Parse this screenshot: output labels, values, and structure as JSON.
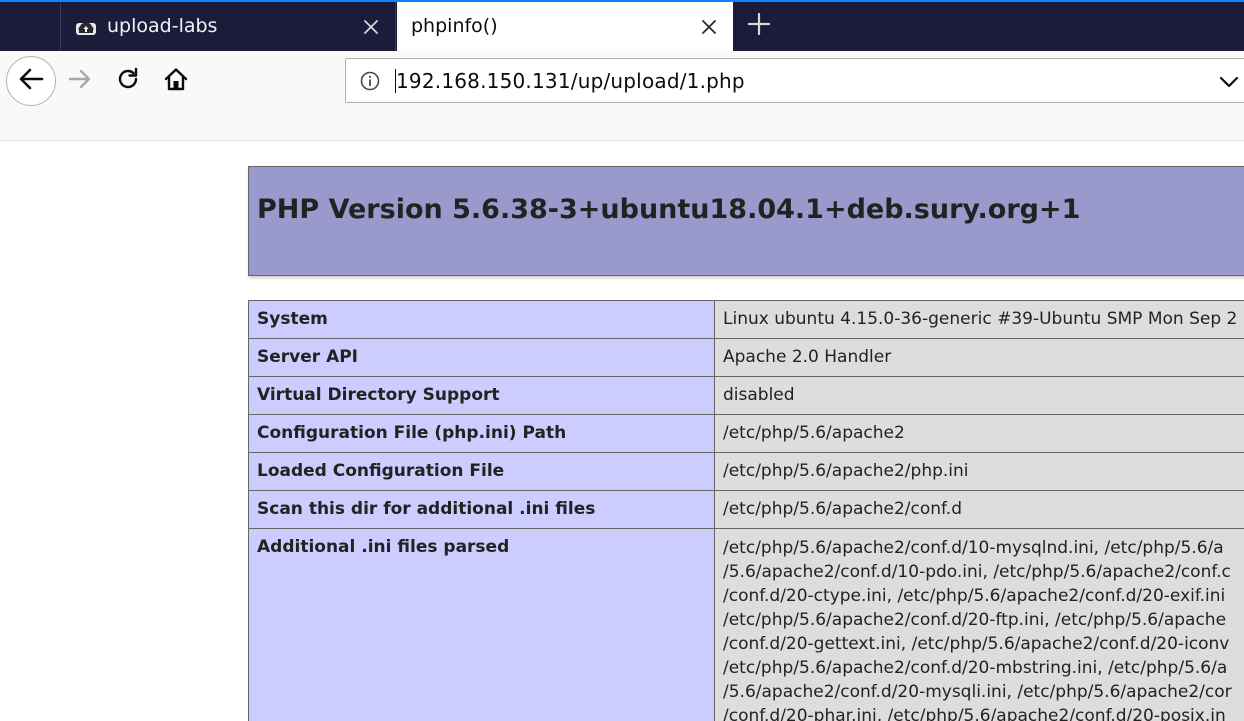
{
  "browser": {
    "tabs": [
      {
        "label": "upload-labs",
        "active": false,
        "favicon": "cloud-icon"
      },
      {
        "label": "phpinfo()",
        "active": true
      }
    ],
    "url": "192.168.150.131/up/upload/1.php",
    "colors": {
      "tabstrip": "#1c1b3a",
      "accent": "#0a84ff",
      "navbar": "#f9f9fa"
    }
  },
  "page": {
    "title": "PHP Version 5.6.38-3+ubuntu18.04.1+deb.sury.org+1",
    "colors": {
      "header": "#9999cc",
      "key_cell": "#ccccff",
      "value_cell": "#dddddd"
    },
    "rows": [
      {
        "key": "System",
        "value": "Linux ubuntu 4.15.0-36-generic #39-Ubuntu SMP Mon Sep 2"
      },
      {
        "key": "Server API",
        "value": "Apache 2.0 Handler"
      },
      {
        "key": "Virtual Directory Support",
        "value": "disabled"
      },
      {
        "key": "Configuration File (php.ini) Path",
        "value": "/etc/php/5.6/apache2"
      },
      {
        "key": "Loaded Configuration File",
        "value": "/etc/php/5.6/apache2/php.ini"
      },
      {
        "key": "Scan this dir for additional .ini files",
        "value": "/etc/php/5.6/apache2/conf.d"
      }
    ],
    "additional": {
      "key": "Additional .ini files parsed",
      "lines": [
        "/etc/php/5.6/apache2/conf.d/10-mysqlnd.ini, /etc/php/5.6/a",
        "/5.6/apache2/conf.d/10-pdo.ini, /etc/php/5.6/apache2/conf.c",
        "/conf.d/20-ctype.ini, /etc/php/5.6/apache2/conf.d/20-exif.ini",
        "/etc/php/5.6/apache2/conf.d/20-ftp.ini, /etc/php/5.6/apache",
        "/conf.d/20-gettext.ini, /etc/php/5.6/apache2/conf.d/20-iconv",
        "/etc/php/5.6/apache2/conf.d/20-mbstring.ini, /etc/php/5.6/a",
        "/5.6/apache2/conf.d/20-mysqli.ini, /etc/php/5.6/apache2/cor",
        "/conf.d/20-phar.ini, /etc/php/5.6/apache2/conf.d/20-posix.in"
      ]
    }
  }
}
